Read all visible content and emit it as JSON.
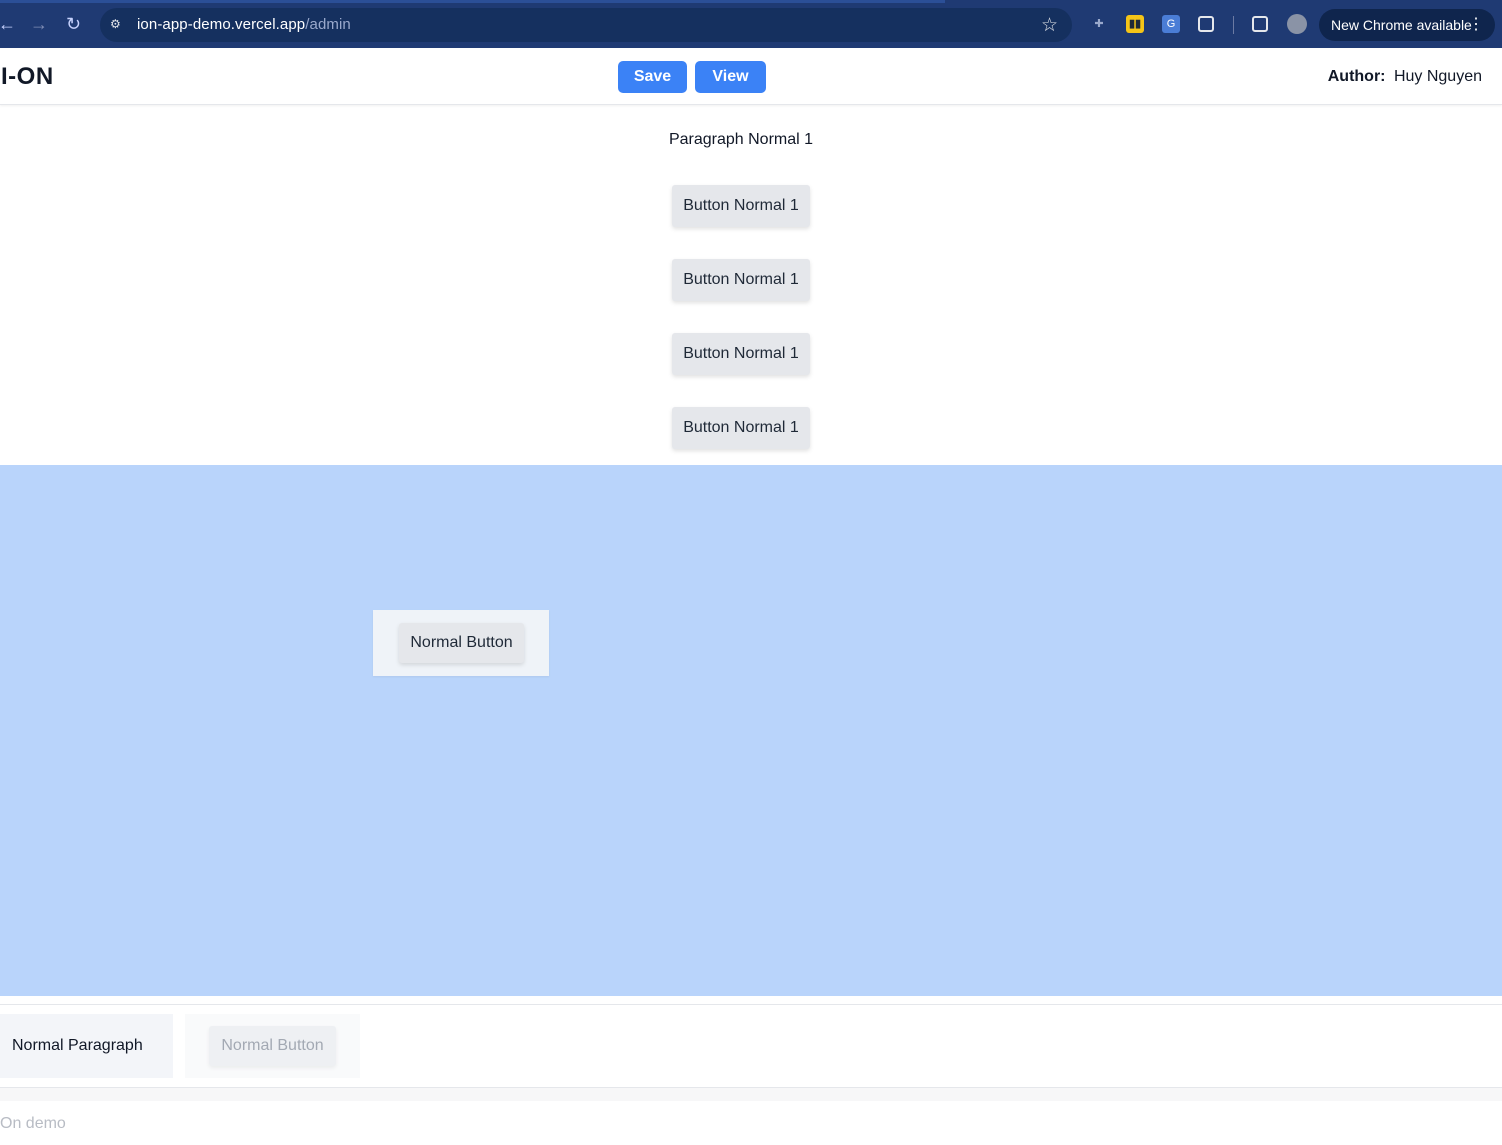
{
  "browser": {
    "url_host": "ion-app-demo.vercel.app",
    "url_path": "/admin",
    "update_label": "New Chrome available"
  },
  "header": {
    "logo": "I-ON",
    "save_label": "Save",
    "view_label": "View",
    "author_label": "Author:",
    "author_name": "Huy Nguyen"
  },
  "canvas": {
    "paragraph": "Paragraph Normal 1",
    "buttons": [
      "Button Normal 1",
      "Button Normal 1",
      "Button Normal 1",
      "Button Normal 1"
    ]
  },
  "dropzone": {
    "dragged_button": "Normal Button"
  },
  "palette": {
    "paragraph_label": "Normal Paragraph",
    "button_label": "Normal Button"
  },
  "footer": {
    "text": "On demo"
  },
  "colors": {
    "primary": "#3b82f6",
    "dropzone": "#b9d4fb",
    "chrome": "#1f3a73"
  }
}
